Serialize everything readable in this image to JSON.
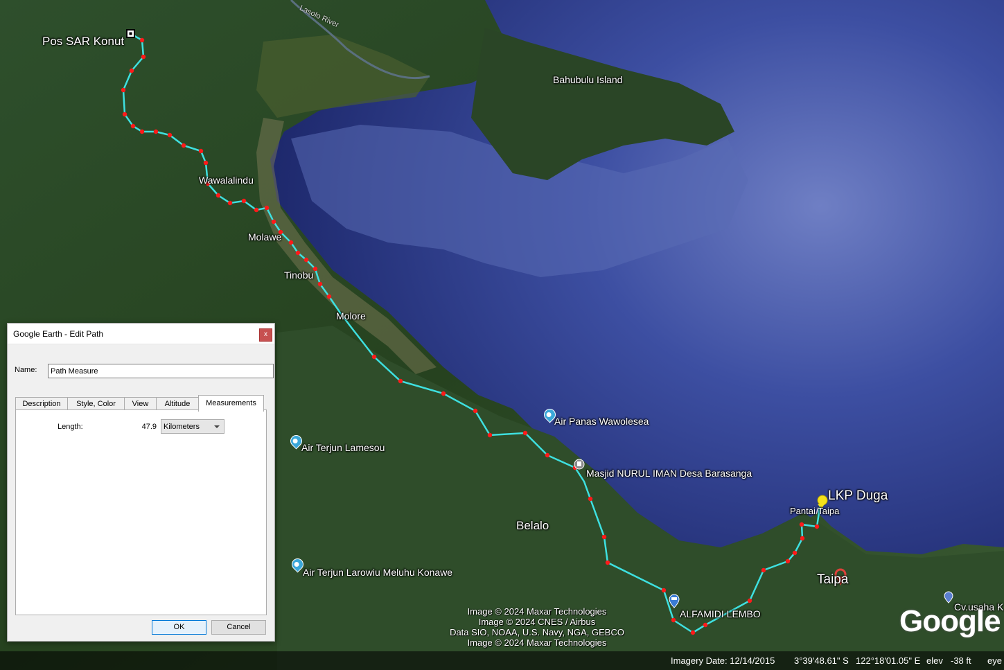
{
  "map": {
    "labels": {
      "pos_sar": "Pos SAR Konut",
      "river": "Lasolo River",
      "bahubulu": "Bahubulu Island",
      "wawalalindu": "Wawalalindu",
      "molawe": "Molawe",
      "tinobu": "Tinobu",
      "molore": "Molore",
      "air_panas": "Air Panas Wawolesea",
      "air_lamesou": "Air Terjun Lamesou",
      "masjid": "Masjid NURUL IMAN Desa Barasanga",
      "belalo": "Belalo",
      "lkp_duga": "LKP Duga",
      "pantai_taipa": "Pantai Taipa",
      "taipa": "Taipa",
      "air_larowiu": "Air Terjun Larowiu Meluhu Konawe",
      "alfamidi": "ALFAMIDI LEMBO",
      "cv_usaha": "Cv.usaha K"
    },
    "credits": [
      "Image © 2024 Maxar Technologies",
      "Image © 2024 CNES / Airbus",
      "Data SIO, NOAA, U.S. Navy, NGA, GEBCO",
      "Image © 2024 Maxar Technologies"
    ],
    "logo": "Google",
    "colors": {
      "path_line": "#3ee0e0",
      "path_vertex": "#ff1a1a",
      "pin": "#f5e11b",
      "water": "#1f2f7a",
      "land": "#2c4a2a"
    }
  },
  "status_bar": {
    "imagery_date": "Imagery Date: 12/14/2015",
    "lat": "3°39'48.61\" S",
    "lon": "122°18'01.05\" E",
    "elev_label": "elev",
    "elev_value": "-38 ft",
    "eye": "eye"
  },
  "dialog": {
    "title": "Google Earth - Edit Path",
    "close": "x",
    "name_label": "Name:",
    "name_value": "Path Measure",
    "tabs": [
      "Description",
      "Style, Color",
      "View",
      "Altitude",
      "Measurements"
    ],
    "active_tab": "Measurements",
    "length_label": "Length:",
    "length_value": "47.9",
    "unit": "Kilometers",
    "ok": "OK",
    "cancel": "Cancel"
  }
}
